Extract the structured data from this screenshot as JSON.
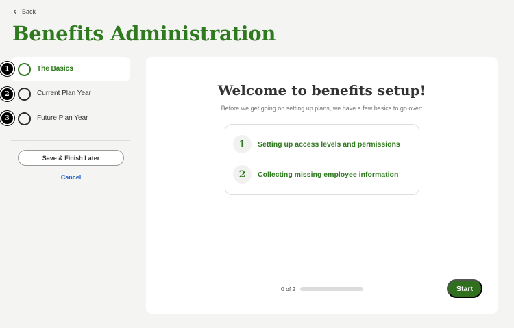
{
  "header": {
    "back_label": "Back",
    "title": "Benefits Administration"
  },
  "sidebar": {
    "steps": [
      {
        "badge": "1",
        "label": "The Basics",
        "active": true
      },
      {
        "badge": "2",
        "label": "Current Plan Year",
        "active": false
      },
      {
        "badge": "3",
        "label": "Future Plan Year",
        "active": false
      }
    ],
    "save_label": "Save & Finish Later",
    "cancel_label": "Cancel"
  },
  "main": {
    "title": "Welcome to benefits setup!",
    "subtitle": "Before we get going on setting up plans, we have a few basics to go over:",
    "items": [
      {
        "number": "1",
        "text": "Setting up access levels and permissions"
      },
      {
        "number": "2",
        "text": "Collecting missing employee information"
      }
    ],
    "progress": {
      "text": "0 of 2",
      "fraction": 0
    },
    "start_label": "Start"
  },
  "colors": {
    "accent": "#2f7a1f",
    "link": "#2563c9",
    "background": "#f4f4f3"
  }
}
